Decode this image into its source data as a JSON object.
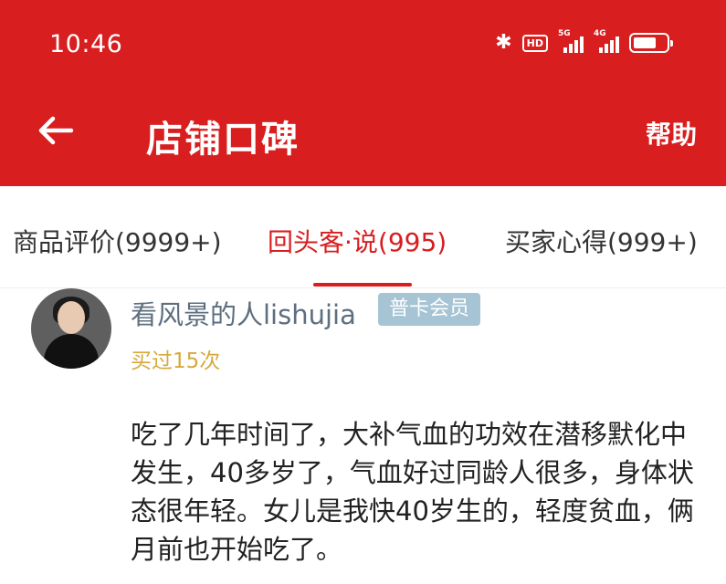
{
  "status_bar": {
    "time": "10:46",
    "bluetooth_icon": "bluetooth-icon",
    "hd_badge": "HD",
    "network_1": "5G",
    "network_2": "4G",
    "battery_icon": "battery-icon"
  },
  "header": {
    "back_icon": "arrow-left-icon",
    "title": "店铺口碑",
    "help_label": "帮助",
    "background_color": "#d81e1f"
  },
  "tabs": [
    {
      "label": "商品评价(9999+)",
      "active": false
    },
    {
      "label": "回头客·说(995)",
      "active": true
    },
    {
      "label": "买家心得(999+)",
      "active": false
    }
  ],
  "review": {
    "avatar": "user-avatar",
    "username": "看风景的人lishujia",
    "member_badge": "普卡会员",
    "purchase_count": "买过15次",
    "text": "吃了几年时间了，大补气血的功效在潜移默化中发生，40多岁了，气血好过同龄人很多，身体状态很年轻。女儿是我快40岁生的，轻度贫血，俩月前也开始吃了。"
  },
  "colors": {
    "accent": "#d81e1f",
    "username": "#5d6e7f",
    "badge": "#a6c4d4",
    "purchase": "#d6a93d"
  }
}
